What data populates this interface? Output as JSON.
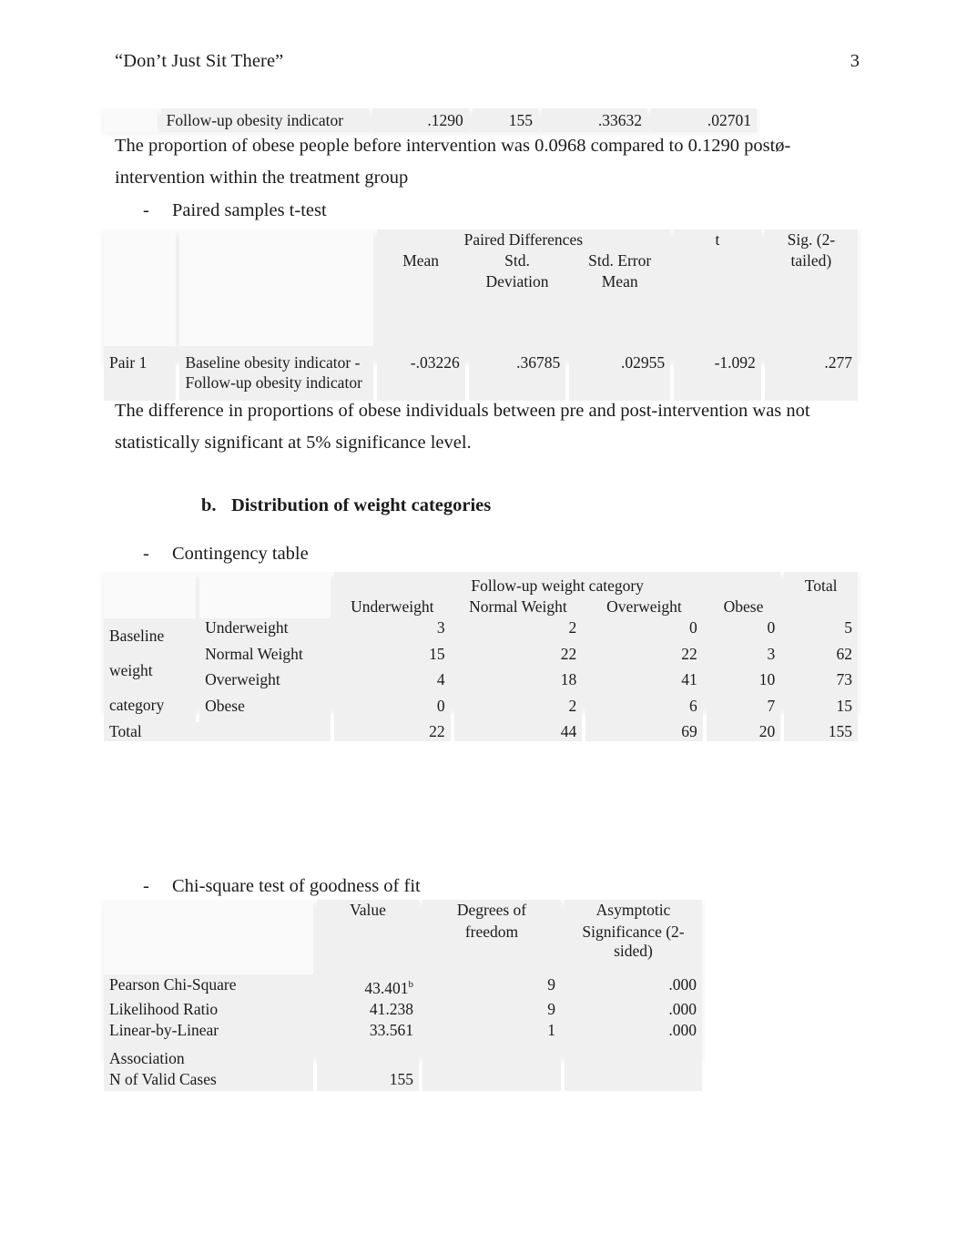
{
  "header": {
    "running_title": "“Don’t Just Sit There”",
    "page_number": "3"
  },
  "table_fragment": {
    "label": "Follow-up obesity indicator",
    "values": [
      ".1290",
      "155",
      ".33632",
      ".02701"
    ]
  },
  "paragraphs": {
    "proportion_text": "The proportion of obese people before intervention was 0.0968 compared to 0.1290 postø-intervention within the treatment group",
    "significance_text": "The difference in proportions of obese individuals between pre and post-intervention was not statistically significant at 5% significance level."
  },
  "headings": {
    "paired_t_test": "Paired samples t-test",
    "section_b_marker": "b.",
    "section_b_label": "Distribution of weight categories",
    "contingency_table": "Contingency table",
    "chi_square": "Chi-square test of goodness of fit",
    "dash": "-"
  },
  "paired_table": {
    "group_header": "Paired Differences",
    "col_t": "t",
    "col_sig_line1": "Sig. (2-",
    "col_sig_line2": "tailed)",
    "col_mean": "Mean",
    "col_std_line1": "Std.",
    "col_std_line2": "Deviation",
    "col_sem_line1": "Std. Error",
    "col_sem_line2": "Mean",
    "row": {
      "pair_label": "Pair 1",
      "variables_line1": "Baseline obesity indicator -",
      "variables_line2": "Follow-up obesity indicator",
      "mean": "-.03226",
      "std_deviation": ".36785",
      "std_error_mean": ".02955",
      "t": "-1.092",
      "sig_2_tailed": ".277"
    }
  },
  "contingency_table": {
    "column_group_header": "Follow-up weight category",
    "total_header": "Total",
    "column_headers": [
      "Underweight",
      "Normal Weight",
      "Overweight",
      "Obese"
    ],
    "row_group_label_lines": [
      "Baseline",
      "weight",
      "category"
    ],
    "rows": [
      {
        "label": "Underweight",
        "values": [
          "3",
          "2",
          "0",
          "0"
        ],
        "total": "5"
      },
      {
        "label": "Normal Weight",
        "values": [
          "15",
          "22",
          "22",
          "3"
        ],
        "total": "62"
      },
      {
        "label": "Overweight",
        "values": [
          "4",
          "18",
          "41",
          "10"
        ],
        "total": "73"
      },
      {
        "label": "Obese",
        "values": [
          "0",
          "2",
          "6",
          "7"
        ],
        "total": "15"
      }
    ],
    "total_row": {
      "label": "Total",
      "values": [
        "22",
        "44",
        "69",
        "20"
      ],
      "total": "155"
    }
  },
  "chi_square_table": {
    "col_value": "Value",
    "col_df_line1": "Degrees of",
    "col_df_line2": "freedom",
    "col_sig_line1": "Asymptotic",
    "col_sig_line2": "Significance (2-sided)",
    "rows": [
      {
        "label": "Pearson Chi-Square",
        "value": "43.401",
        "value_sup": "b",
        "df": "9",
        "sig": ".000"
      },
      {
        "label": "Likelihood Ratio",
        "value": "41.238",
        "value_sup": "",
        "df": "9",
        "sig": ".000"
      },
      {
        "label": "Linear-by-Linear",
        "value": "33.561",
        "value_sup": "",
        "df": "1",
        "sig": ".000"
      },
      {
        "label": "Association",
        "value": "",
        "value_sup": "",
        "df": "",
        "sig": ""
      },
      {
        "label": "N of Valid Cases",
        "value": "155",
        "value_sup": "",
        "df": "",
        "sig": ""
      }
    ]
  }
}
